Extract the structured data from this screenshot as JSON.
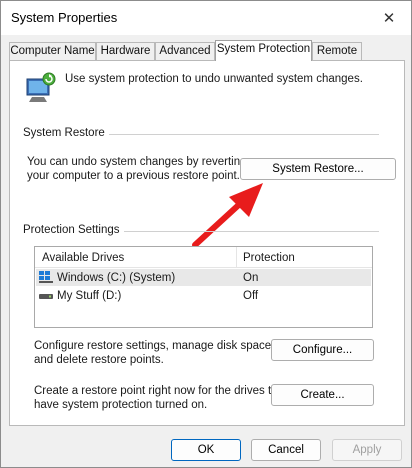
{
  "window": {
    "title": "System Properties",
    "close_glyph": "✕"
  },
  "tabs": [
    {
      "label": "Computer Name"
    },
    {
      "label": "Hardware"
    },
    {
      "label": "Advanced"
    },
    {
      "label": "System Protection",
      "active": true
    },
    {
      "label": "Remote"
    }
  ],
  "intro": {
    "text": "Use system protection to undo unwanted system changes.",
    "icon": "computer-restore-icon"
  },
  "system_restore": {
    "group_title": "System Restore",
    "description_line1": "You can undo system changes by reverting",
    "description_line2": "your computer to a previous restore point.",
    "button_label": "System Restore..."
  },
  "protection": {
    "group_title": "Protection Settings",
    "columns": [
      "Available Drives",
      "Protection"
    ],
    "drives": [
      {
        "name": "Windows (C:) (System)",
        "protection": "On",
        "icon": "windows-drive-icon",
        "selected": true
      },
      {
        "name": "My Stuff (D:)",
        "protection": "Off",
        "icon": "hard-drive-icon",
        "selected": false
      }
    ],
    "configure_line1": "Configure restore settings, manage disk space,",
    "configure_line2": "and delete restore points.",
    "configure_label": "Configure...",
    "create_line1": "Create a restore point right now for the drives that",
    "create_line2": "have system protection turned on.",
    "create_label": "Create..."
  },
  "annotation": {
    "arrow_color": "#e81c1c"
  },
  "footer": {
    "ok_label": "OK",
    "cancel_label": "Cancel",
    "apply_label": "Apply"
  },
  "colors": {
    "accent": "#0067c0"
  }
}
